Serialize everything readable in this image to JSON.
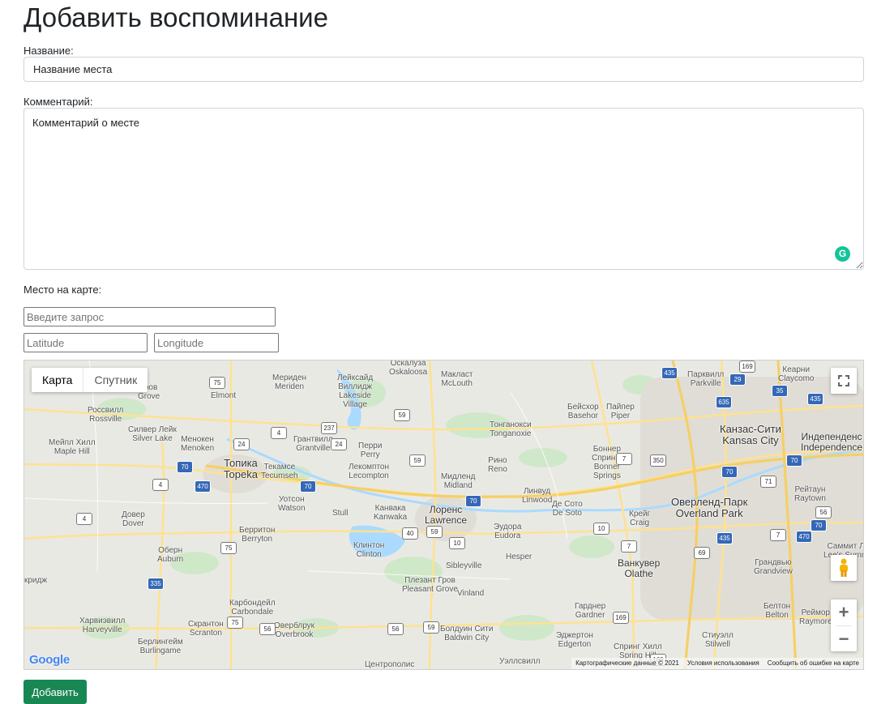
{
  "page": {
    "title": "Добавить воспоминание"
  },
  "form": {
    "name_label": "Название:",
    "name_placeholder": "Название места",
    "comment_label": "Комментарий:",
    "comment_placeholder": "Комментарий о месте",
    "location_label": "Место на карте:",
    "search_placeholder": "Введите запрос",
    "latitude_placeholder": "Latitude",
    "longitude_placeholder": "Longitude",
    "submit_label": "Добавить"
  },
  "map": {
    "type_controls": [
      "Карта",
      "Спутник"
    ],
    "active_type": "Карта",
    "zoom_in": "+",
    "zoom_out": "−",
    "logo": "Google",
    "attribution": [
      "Картографические данные © 2021",
      "Условия использования",
      "Сообщить об ошибке на карте"
    ],
    "places": [
      {
        "text": "Топика\nTopeka",
        "cls": "big"
      },
      {
        "text": "Лоренс\nLawrence",
        "cls": "mid"
      },
      {
        "text": "Канзас-Сити\nKansas City",
        "cls": "big"
      },
      {
        "text": "Оверленд-Парк\nOverland Park",
        "cls": "big"
      },
      {
        "text": "Индепенденс\nIndependence",
        "cls": "mid"
      },
      {
        "text": "Ванкувер\nOlathe",
        "cls": "mid"
      },
      {
        "text": "Оскалуза\nOskaloosa",
        "cls": ""
      },
      {
        "text": "Мериден\nMeriden",
        "cls": ""
      },
      {
        "text": "Лейксайд\nВиллидж\nLakeside\nVillage",
        "cls": ""
      },
      {
        "text": "Макласт\nMcLouth",
        "cls": ""
      },
      {
        "text": "Парквилл\nParkville",
        "cls": ""
      },
      {
        "text": "Кеарни\nClaycomo",
        "cls": ""
      },
      {
        "text": "Гров\nGrove",
        "cls": ""
      },
      {
        "text": "Elmont",
        "cls": ""
      },
      {
        "text": "Бейсхор\nBasehor",
        "cls": ""
      },
      {
        "text": "Пайпер\nPiper",
        "cls": ""
      },
      {
        "text": "Россвилл\nRossville",
        "cls": ""
      },
      {
        "text": "Силвер Лейк\nSilver Lake",
        "cls": ""
      },
      {
        "text": "Менокен\nMenoken",
        "cls": ""
      },
      {
        "text": "Грантвилл\nGrantville",
        "cls": ""
      },
      {
        "text": "Тонганокси\nTonganoxie",
        "cls": ""
      },
      {
        "text": "Мейпл Хилл\nMaple Hill",
        "cls": ""
      },
      {
        "text": "Перри\nPerry",
        "cls": ""
      },
      {
        "text": "Боннер\nСпрингс\nBonner\nSprings",
        "cls": ""
      },
      {
        "text": "Текамсе\nTecumseh",
        "cls": ""
      },
      {
        "text": "Лекомптон\nLecompton",
        "cls": ""
      },
      {
        "text": "Рино\nReno",
        "cls": ""
      },
      {
        "text": "Мидленд\nMidland",
        "cls": ""
      },
      {
        "text": "Линвуд\nLinwood",
        "cls": ""
      },
      {
        "text": "Де Сото\nDe Soto",
        "cls": ""
      },
      {
        "text": "Крейг\nCraig",
        "cls": ""
      },
      {
        "text": "Рейтаун\nRaytown",
        "cls": ""
      },
      {
        "text": "Уотсон\nWatson",
        "cls": ""
      },
      {
        "text": "Stull",
        "cls": ""
      },
      {
        "text": "Канвака\nKanwaka",
        "cls": ""
      },
      {
        "text": "Довер\nDover",
        "cls": ""
      },
      {
        "text": "Берритон\nBerryton",
        "cls": ""
      },
      {
        "text": "Эудора\nEudora",
        "cls": ""
      },
      {
        "text": "Клинтон\nClinton",
        "cls": ""
      },
      {
        "text": "Оберн\nAuburn",
        "cls": ""
      },
      {
        "text": "Hesper",
        "cls": ""
      },
      {
        "text": "Саммит Л\nLee's Summ",
        "cls": ""
      },
      {
        "text": "Грандвью\nGrandview",
        "cls": ""
      },
      {
        "text": "Sibleyville",
        "cls": ""
      },
      {
        "text": "Плезант Гров\nPleasant Grove",
        "cls": ""
      },
      {
        "text": "Vinland",
        "cls": ""
      },
      {
        "text": "Карбондейл\nCarbondale",
        "cls": ""
      },
      {
        "text": "Гарднер\nGardner",
        "cls": ""
      },
      {
        "text": "Белтон\nBelton",
        "cls": ""
      },
      {
        "text": "Реймор\nRaymore",
        "cls": ""
      },
      {
        "text": "кридж",
        "cls": ""
      },
      {
        "text": "Харвиэвилл\nHarveyville",
        "cls": ""
      },
      {
        "text": "Скрантон\nScranton",
        "cls": ""
      },
      {
        "text": "Оверблрук\nOverbrook",
        "cls": ""
      },
      {
        "text": "Болдуин Сити\nBaldwin City",
        "cls": ""
      },
      {
        "text": "Эджертон\nEdgerton",
        "cls": ""
      },
      {
        "text": "Стиуэлл\nStilwell",
        "cls": ""
      },
      {
        "text": "Берлингейм\nBurlingame",
        "cls": ""
      },
      {
        "text": "Спринг Хилл\nSpring Hill",
        "cls": ""
      },
      {
        "text": "Центрополис",
        "cls": ""
      },
      {
        "text": "Уэллсвилл",
        "cls": ""
      }
    ],
    "shields": [
      {
        "n": "75",
        "t": "us"
      },
      {
        "n": "59",
        "t": "us"
      },
      {
        "n": "237",
        "t": "us"
      },
      {
        "n": "4",
        "t": "us"
      },
      {
        "n": "24",
        "t": "us"
      },
      {
        "n": "24",
        "t": "us"
      },
      {
        "n": "70",
        "t": "i"
      },
      {
        "n": "470",
        "t": "i"
      },
      {
        "n": "4",
        "t": "us"
      },
      {
        "n": "4",
        "t": "us"
      },
      {
        "n": "70",
        "t": "i"
      },
      {
        "n": "59",
        "t": "us"
      },
      {
        "n": "70",
        "t": "i"
      },
      {
        "n": "40",
        "t": "us"
      },
      {
        "n": "59",
        "t": "us"
      },
      {
        "n": "10",
        "t": "us"
      },
      {
        "n": "10",
        "t": "us"
      },
      {
        "n": "75",
        "t": "us"
      },
      {
        "n": "335",
        "t": "i"
      },
      {
        "n": "75",
        "t": "us"
      },
      {
        "n": "56",
        "t": "us"
      },
      {
        "n": "56",
        "t": "us"
      },
      {
        "n": "59",
        "t": "us"
      },
      {
        "n": "435",
        "t": "i"
      },
      {
        "n": "169",
        "t": "us"
      },
      {
        "n": "29",
        "t": "i"
      },
      {
        "n": "635",
        "t": "i"
      },
      {
        "n": "35",
        "t": "i"
      },
      {
        "n": "70",
        "t": "i"
      },
      {
        "n": "7",
        "t": "us"
      },
      {
        "n": "70",
        "t": "i"
      },
      {
        "n": "7",
        "t": "us"
      },
      {
        "n": "435",
        "t": "i"
      },
      {
        "n": "7",
        "t": "us"
      },
      {
        "n": "69",
        "t": "us"
      },
      {
        "n": "470",
        "t": "i"
      },
      {
        "n": "169",
        "t": "us"
      },
      {
        "n": "71",
        "t": "us"
      },
      {
        "n": "350",
        "t": "us"
      },
      {
        "n": "435",
        "t": "i"
      },
      {
        "n": "70",
        "t": "i"
      },
      {
        "n": "56",
        "t": "us"
      },
      {
        "n": "169",
        "t": "us"
      }
    ]
  }
}
